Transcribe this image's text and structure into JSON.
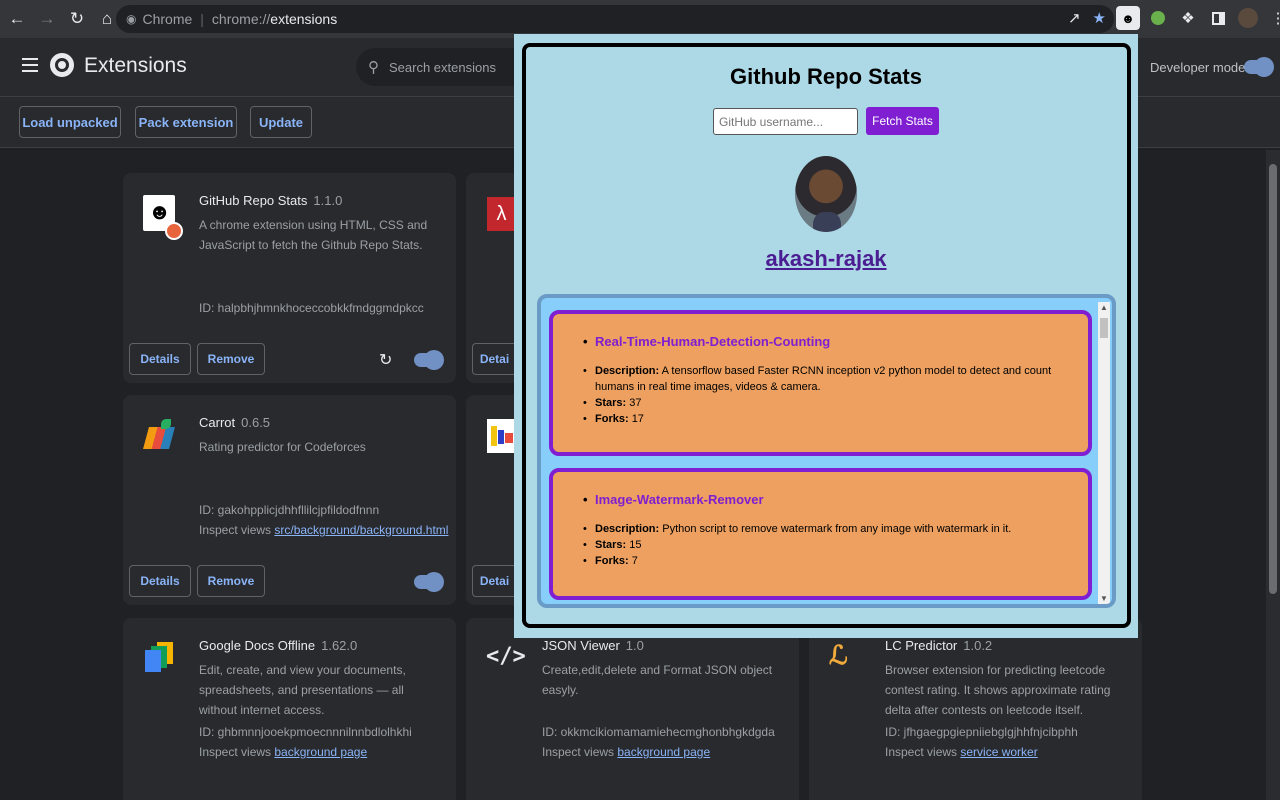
{
  "browser": {
    "site_label": "Chrome",
    "url_prefix": "chrome://",
    "url_path": "extensions"
  },
  "header": {
    "title": "Extensions",
    "search_placeholder": "Search extensions",
    "developer_mode_label": "Developer mode",
    "developer_mode": true
  },
  "toolbar": {
    "load_unpacked": "Load unpacked",
    "pack_extension": "Pack extension",
    "update": "Update"
  },
  "cards": [
    {
      "name": "GitHub Repo Stats",
      "version": "1.1.0",
      "description": "A chrome extension using HTML, CSS and JavaScript to fetch the Github Repo Stats.",
      "id": "ID: halpbhjhmnkhoceccobkkfmdggmdpkcc",
      "details": "Details",
      "remove": "Remove",
      "enabled": true
    },
    {
      "name": "Carrot",
      "version": "0.6.5",
      "description": "Rating predictor for Codeforces",
      "id": "ID: gakohpplicjdhhfllilcjpfildodfnnn",
      "inspect_label": "Inspect views",
      "inspect_link": "src/background/background.html",
      "details": "Details",
      "remove": "Remove",
      "enabled": true
    },
    {
      "name": "Google Docs Offline",
      "version": "1.62.0",
      "description": "Edit, create, and view your documents, spreadsheets, and presentations — all without internet access.",
      "id": "ID: ghbmnnjooekpmoecnnnilnnbdlolhkhi",
      "inspect_label": "Inspect views",
      "inspect_link": "background page"
    },
    {
      "name": "JSON Viewer",
      "version": "1.0",
      "description": "Create,edit,delete and Format JSON object easyly.",
      "id": "ID: okkmcikiomamamiehecmghonbhgkdgda",
      "inspect_label": "Inspect views",
      "inspect_link": "background page"
    },
    {
      "name": "LC Predictor",
      "version": "1.0.2",
      "description": "Browser extension for predicting leetcode contest rating. It shows approximate rating delta after contests on leetcode itself.",
      "id": "ID: jfhgaegpgiepniiebglgjhhfnjcibphh",
      "inspect_label": "Inspect views",
      "inspect_link": "service worker"
    }
  ],
  "partial_details_label": "Detai",
  "popup": {
    "title": "Github Repo Stats",
    "input_placeholder": "GitHub username...",
    "fetch_button": "Fetch Stats",
    "username": "akash-rajak",
    "repos": [
      {
        "name": "Real-Time-Human-Detection-Counting",
        "description_label": "Description:",
        "description": "A tensorflow based Faster RCNN inception v2 python model to detect and count humans in real time images, videos & camera.",
        "stars_label": "Stars:",
        "stars": "37",
        "forks_label": "Forks:",
        "forks": "17"
      },
      {
        "name": "Image-Watermark-Remover",
        "description_label": "Description:",
        "description": "Python script to remove watermark from any image with watermark in it.",
        "stars_label": "Stars:",
        "stars": "15",
        "forks_label": "Forks:",
        "forks": "7"
      }
    ]
  },
  "colors": {
    "accent": "#8ab4f8",
    "popup_bg": "#add8e6",
    "repo_card_bg": "#eda060",
    "repo_border": "#7f1fd1"
  }
}
